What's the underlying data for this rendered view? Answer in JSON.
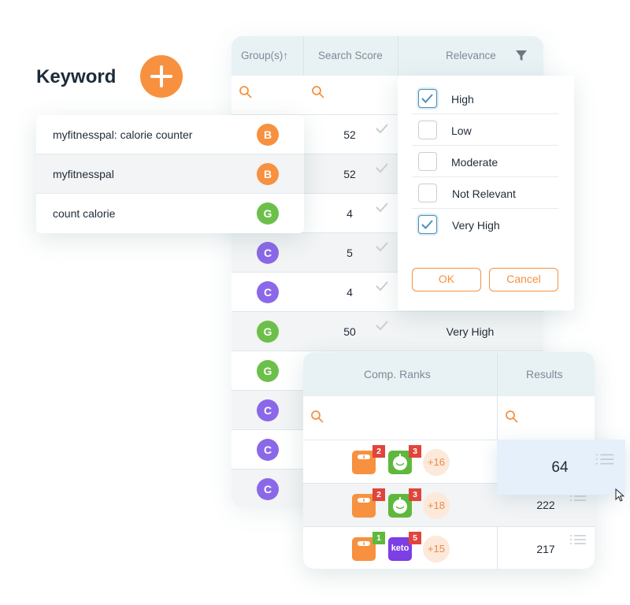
{
  "keyword_section": {
    "title": "Keyword",
    "rows": [
      {
        "text": "myfitnesspal: calorie counter"
      },
      {
        "text": "myfitnesspal"
      },
      {
        "text": "count calorie"
      }
    ]
  },
  "grid": {
    "headers": {
      "group": "Group(s)↑",
      "search_score": "Search Score",
      "relevance": "Relevance"
    },
    "rows": [
      {
        "group": "B",
        "score": "52",
        "relevance": ""
      },
      {
        "group": "B",
        "score": "52",
        "relevance": ""
      },
      {
        "group": "G",
        "score": "4",
        "relevance": ""
      },
      {
        "group": "C",
        "score": "5",
        "relevance": ""
      },
      {
        "group": "C",
        "score": "4",
        "relevance": ""
      },
      {
        "group": "G",
        "score": "50",
        "relevance": "Very High"
      },
      {
        "group": "G",
        "score": "",
        "relevance": ""
      },
      {
        "group": "C",
        "score": "",
        "relevance": ""
      },
      {
        "group": "C",
        "score": "",
        "relevance": ""
      },
      {
        "group": "C",
        "score": "",
        "relevance": ""
      }
    ]
  },
  "relevance_filter": {
    "options": [
      {
        "label": "High",
        "checked": true
      },
      {
        "label": "Low",
        "checked": false
      },
      {
        "label": "Moderate",
        "checked": false
      },
      {
        "label": "Not Relevant",
        "checked": false
      },
      {
        "label": "Very High",
        "checked": true
      }
    ],
    "ok_label": "OK",
    "cancel_label": "Cancel"
  },
  "comp_table": {
    "headers": {
      "comp_ranks": "Comp. Ranks",
      "results": "Results"
    },
    "rows": [
      {
        "ranks": [
          "2",
          "3"
        ],
        "more": "+16",
        "result": "64"
      },
      {
        "ranks": [
          "2",
          "3"
        ],
        "more": "+18",
        "result": "222"
      },
      {
        "ranks": [
          "1",
          "5"
        ],
        "more": "+15",
        "result": "217"
      }
    ],
    "second_app_label": "keto"
  },
  "colors": {
    "accent_orange": "#f7913f",
    "badge_B": "#f7913f",
    "badge_G": "#6cc04a",
    "badge_C": "#8a68e8",
    "rank_red": "#e0453c",
    "rank_green": "#5fb83d",
    "checkbox_blue": "#4a90b8",
    "header_tint": "#e8f2f4"
  }
}
